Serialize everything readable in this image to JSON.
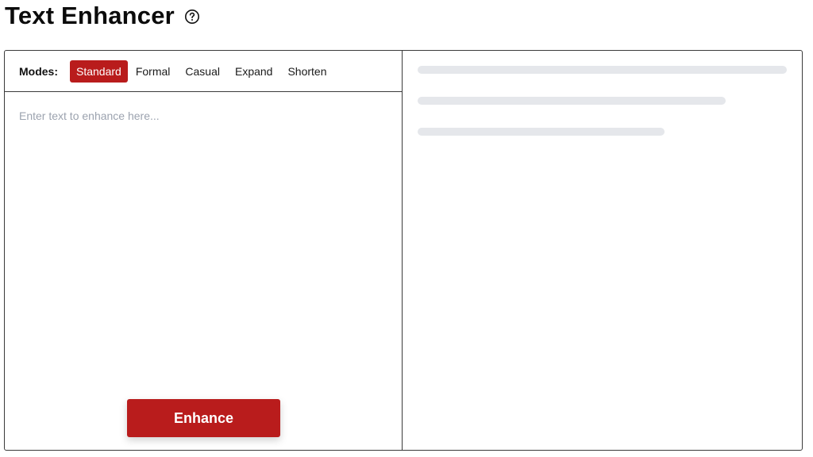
{
  "header": {
    "title": "Text Enhancer",
    "help_icon": "question-circle-icon"
  },
  "modes": {
    "label": "Modes:",
    "options": [
      "Standard",
      "Formal",
      "Casual",
      "Expand",
      "Shorten"
    ],
    "selected": "Standard"
  },
  "input": {
    "placeholder": "Enter text to enhance here...",
    "value": ""
  },
  "actions": {
    "enhance_label": "Enhance"
  },
  "output": {
    "state": "loading"
  },
  "colors": {
    "accent": "#b91c1c",
    "skeleton": "#e5e7eb",
    "border": "#3a3a3a",
    "placeholder": "#9ca3af"
  }
}
